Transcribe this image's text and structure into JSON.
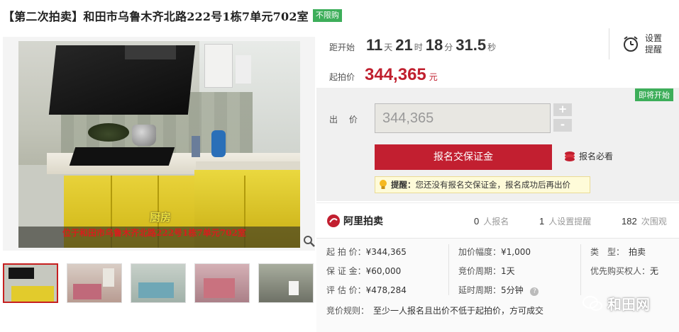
{
  "title": {
    "text": "【第二次拍卖】和田市乌鲁木齐北路222号1栋7单元702室",
    "tag": "不限购"
  },
  "photo": {
    "caption_room": "厨房",
    "caption_location": "位于和田市乌鲁木齐北路222号1栋7单元702室"
  },
  "countdown": {
    "label": "距开始",
    "days": "11",
    "days_unit": "天",
    "hours": "21",
    "hours_unit": "时",
    "minutes": "18",
    "minutes_unit": "分",
    "seconds": "31.5",
    "seconds_unit": "秒"
  },
  "start_price": {
    "label": "起拍价",
    "value": "344,365",
    "unit": "元"
  },
  "remind": {
    "label": "设置提醒"
  },
  "bid": {
    "badge": "即将开始",
    "label": "出 价",
    "value": "344,365",
    "plus": "+",
    "minus": "-",
    "deposit_button": "报名交保证金",
    "must_read": "报名必看",
    "tip_bold": "提醒：",
    "tip_text": "您还没有报名交保证金，报名成功后再出价"
  },
  "stats": {
    "brand": "阿里拍卖",
    "signups_num": "0",
    "signups_label": "人报名",
    "reminders_num": "1",
    "reminders_label": "人设置提醒",
    "views_num": "182",
    "views_label": "次围观"
  },
  "info": {
    "start_price_label": "起 拍 价：",
    "start_price": "¥344,365",
    "deposit_label": "保 证 金：",
    "deposit": "¥60,000",
    "appraisal_label": "评 估 价：",
    "appraisal": "¥478,284",
    "increment_label": "加价幅度：",
    "increment": "¥1,000",
    "period_label": "竞价周期：",
    "period": "1天",
    "extension_label": "延时周期：",
    "extension": "5分钟",
    "type_label": "类　型：",
    "type": "拍卖",
    "priority_label": "优先购买权人：",
    "priority": "无",
    "rule_label": "竞价规则：",
    "rule": "至少一人报名且出价不低于起拍价，方可成交"
  },
  "watermark": "和田网",
  "colors": {
    "accent_red": "#c21f30",
    "badge_green": "#3dae5a",
    "tip_bg": "#fefbd9"
  }
}
